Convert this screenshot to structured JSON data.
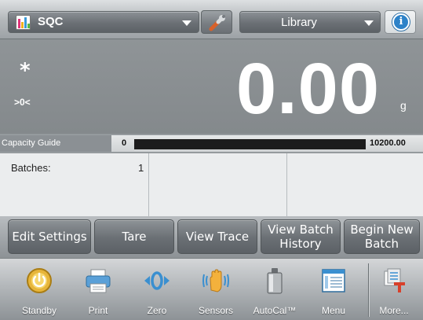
{
  "top_bar": {
    "app_name": "SQC",
    "library_label": "Library",
    "icons": {
      "app": "sqc-chart-icon",
      "settings": "wrench-icon",
      "info": "info-icon"
    },
    "info_glyph": "i"
  },
  "display": {
    "stability_indicator": "*",
    "center_of_zero": ">0<",
    "weight": "0.00",
    "unit": "g"
  },
  "capacity_guide": {
    "label": "Capacity Guide",
    "min": "0",
    "max": "10200.00",
    "fill_fraction": 0.0,
    "fill_color": "#2f9a3a",
    "track_color": "#1c1c1c"
  },
  "info_panel": {
    "batches_label": "Batches:",
    "batches_value": "1"
  },
  "soft_keys": [
    {
      "label": "Edit Settings"
    },
    {
      "label": "Tare"
    },
    {
      "label": "View Trace"
    },
    {
      "label": "View Batch\nHistory"
    },
    {
      "label": "Begin New\nBatch"
    }
  ],
  "nav": [
    {
      "label": "Standby",
      "icon": "standby-icon"
    },
    {
      "label": "Print",
      "icon": "printer-icon"
    },
    {
      "label": "Zero",
      "icon": "zero-icon"
    },
    {
      "label": "Sensors",
      "icon": "sensors-hand-icon"
    },
    {
      "label": "AutoCal™",
      "icon": "autocal-weight-icon"
    },
    {
      "label": "Menu",
      "icon": "menu-icon"
    },
    {
      "label": "More...",
      "icon": "more-icon"
    }
  ],
  "colors": {
    "accent_blue": "#2d82c8",
    "display_bg": "#8f9497"
  }
}
